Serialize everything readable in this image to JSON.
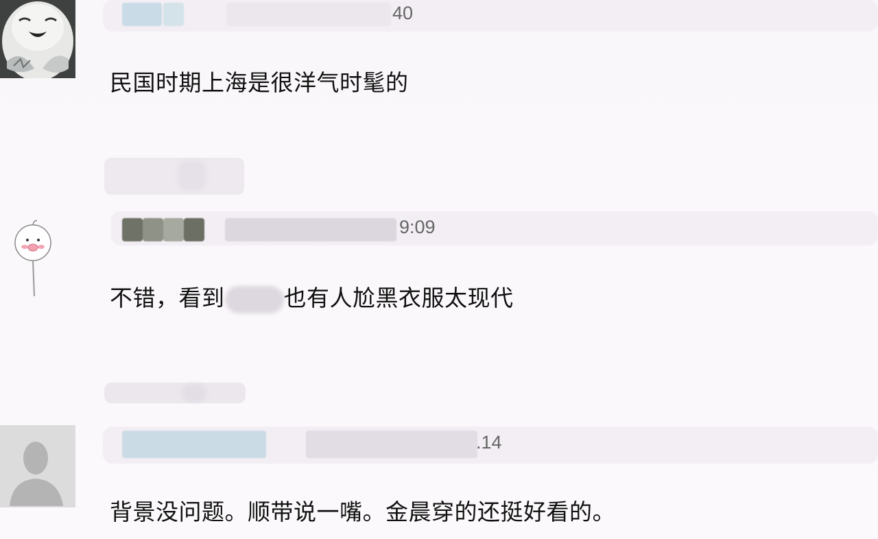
{
  "comments": [
    {
      "time": "40",
      "text": "民国时期上海是很洋气时髦的",
      "avatar": "owl-avatar"
    },
    {
      "time": "9:09",
      "text_before": "不错，看到",
      "text_after": "也有人尬黑衣服太现代",
      "avatar": "chick-lollipop-avatar"
    },
    {
      "time": ".14",
      "text": "背景没问题。顺带说一嘴。金晨穿的还挺好看的。",
      "avatar": "default-user-avatar"
    }
  ]
}
